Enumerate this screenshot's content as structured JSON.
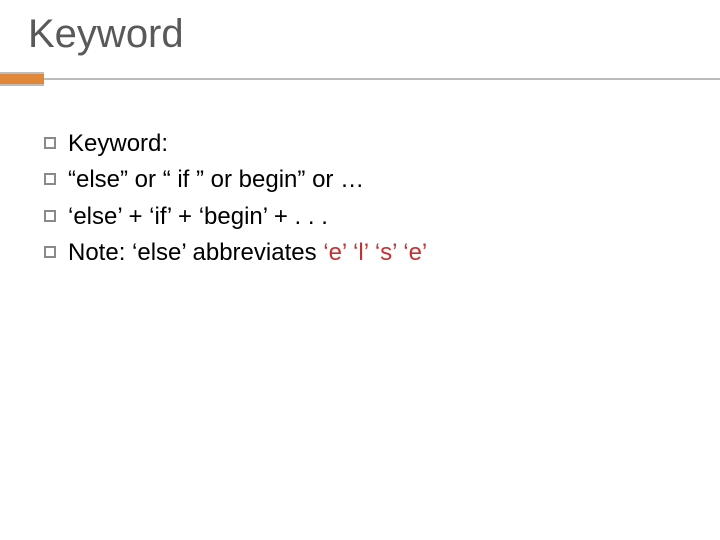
{
  "title": "Keyword",
  "bullets": {
    "b1": "Keyword:",
    "b2": "“else” or “ if ” or begin” or …",
    "b3": "‘else’ + ‘if’ + ‘begin’ + . . .",
    "b4_prefix": "Note: ‘else’ abbreviates ",
    "b4_abbr": "‘e’ ‘l’ ‘s’ ‘e’"
  }
}
